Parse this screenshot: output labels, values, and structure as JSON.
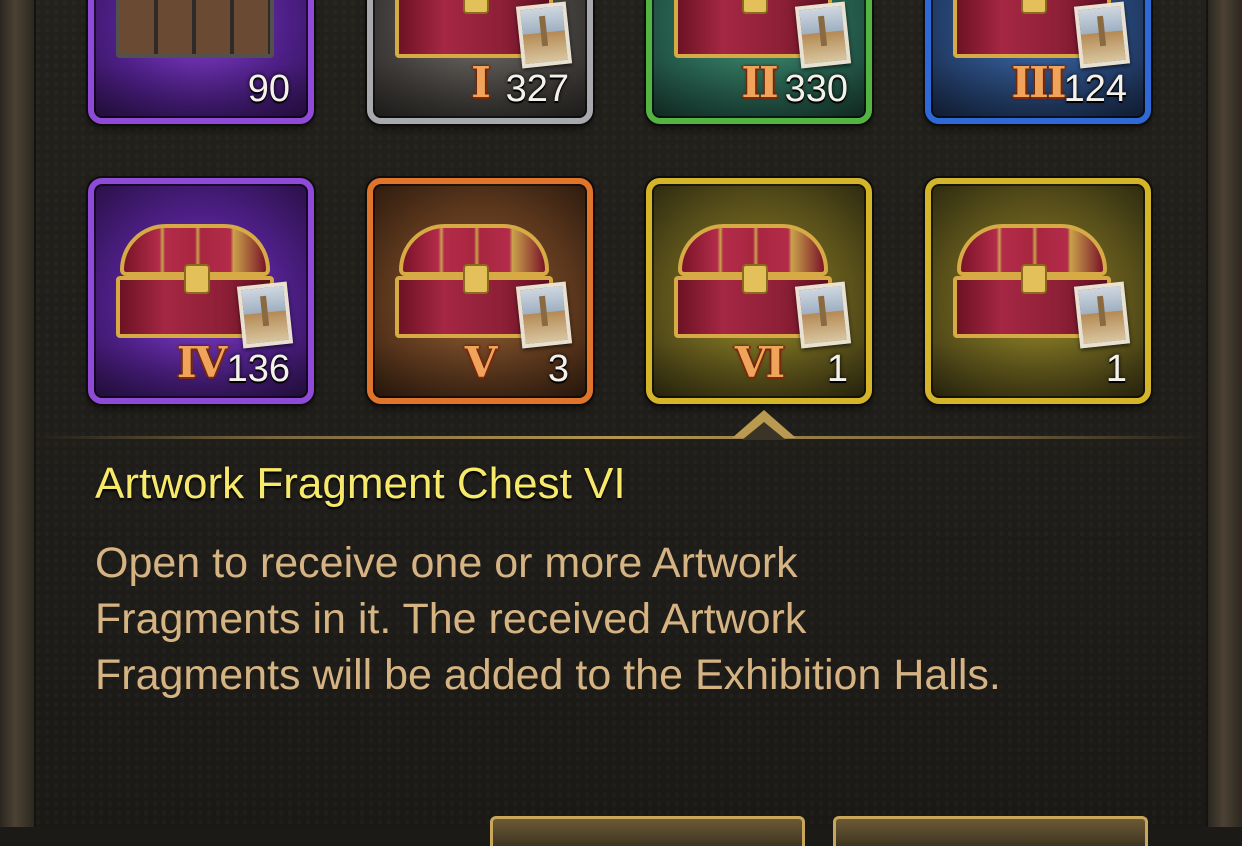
{
  "slots": [
    {
      "name": "gem-chest",
      "tier": "",
      "count": "90",
      "rarity": "purple"
    },
    {
      "name": "artwork-fragment-chest-i",
      "tier": "I",
      "count": "327",
      "rarity": "grey"
    },
    {
      "name": "artwork-fragment-chest-ii",
      "tier": "II",
      "count": "330",
      "rarity": "green"
    },
    {
      "name": "artwork-fragment-chest-iii",
      "tier": "III",
      "count": "124",
      "rarity": "blue"
    },
    {
      "name": "artwork-fragment-chest-iv",
      "tier": "IV",
      "count": "136",
      "rarity": "purple"
    },
    {
      "name": "artwork-fragment-chest-v",
      "tier": "V",
      "count": "3",
      "rarity": "orange"
    },
    {
      "name": "artwork-fragment-chest-vi",
      "tier": "VI",
      "count": "1",
      "rarity": "gold",
      "selected": true
    },
    {
      "name": "artwork-fragment-chest-gold",
      "tier": "",
      "count": "1",
      "rarity": "gold"
    }
  ],
  "detail": {
    "title": "Artwork Fragment Chest VI",
    "description": "Open to receive one or more Artwork\nFragments in it.  The received Artwork\nFragments will be added to the Exhibition Halls."
  },
  "colors": {
    "title": "#f7e96a",
    "description": "#d6b382",
    "panel": "#1f1d19"
  }
}
